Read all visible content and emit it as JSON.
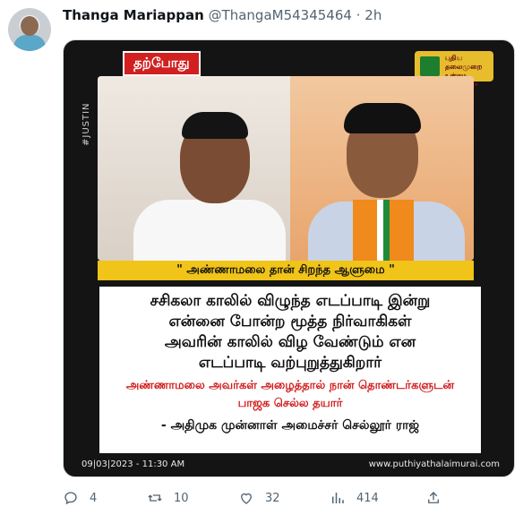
{
  "tweet": {
    "display_name": "Thanga Mariappan",
    "handle": "@ThangaM54345464",
    "separator": "·",
    "time": "2h"
  },
  "media": {
    "badge": "தற்போது",
    "channel_logo_lines": [
      "புதிய",
      "தலைமுறை",
      "உண்மை உடனுக்குடன்"
    ],
    "side_tag": "#JUSTIN",
    "quote": "\" அண்ணாமலை தான் சிறந்த ஆளுமை \"",
    "caption_main": [
      "சசிகலா காலில் விழுந்த எடப்பாடி இன்று",
      "என்னை போன்ற மூத்த நிர்வாகிகள்",
      "அவரின் காலில் விழ வேண்டும் என",
      "எடப்பாடி வற்புறுத்துகிறார்"
    ],
    "caption_red": [
      "அண்ணாமலை அவர்கள் அழைத்தால் நான் தொண்டர்களுடன்",
      "பாஜக செல்ல தயார்"
    ],
    "caption_source": "- அதிமுக முன்னாள் அமைச்சர் செல்லூர் ராஜ்",
    "date": "09|03|2023 - 11:30 AM",
    "website": "www.puthiyathalaimurai.com"
  },
  "actions": {
    "replies": "4",
    "retweets": "10",
    "likes": "32",
    "views": "414"
  }
}
